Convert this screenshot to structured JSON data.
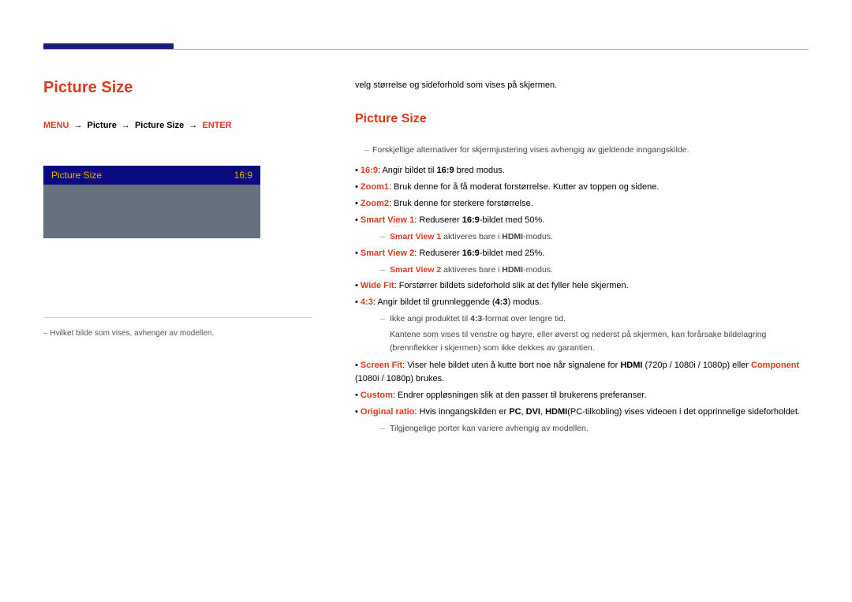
{
  "left": {
    "title_hdr": "Picture Size",
    "title_hdr_overlay": "Picture Size",
    "breadcrumb": {
      "a": "MENU",
      "b": "Picture",
      "c": "Picture Size",
      "d": "ENTER"
    },
    "menu": {
      "label": "Picture Size",
      "value": "16:9"
    },
    "note": "Hvilket bilde som vises, avhenger av modellen."
  },
  "right": {
    "intro": "velg størrelse og sideforhold som vises på skjermen.",
    "h2": "Picture Size",
    "dash1": "Forskjellige alternativer for skjermjustering vises avhengig av gjeldende inngangskilde.",
    "i1_pre": "• ",
    "i1_b": "16:9",
    "i1_txt": ": Angir bildet til ",
    "i1_b2": "16:9",
    "i1_suf": " bred modus.",
    "i2_pre": "• ",
    "i2_b": "Zoom1",
    "i2_txt": ": Bruk denne for å få moderat forstørrelse. Kutter av toppen og sidene.",
    "i3_pre": "• ",
    "i3_b": "Zoom2",
    "i3_txt": ": Bruk denne for sterkere forstørrelse.",
    "i4_pre": "• ",
    "i4_b": "Smart View 1",
    "i4_txt": ": Reduserer ",
    "i4_b2": "16:9",
    "i4_suf": "-bildet med 50%.",
    "i4_note_b": "Smart View 1",
    "i4_note_txt": " aktiveres bare i ",
    "i4_note_b2": "HDMI",
    "i4_note_suf": "-modus.",
    "i5_pre": "• ",
    "i5_b": "Smart View 2",
    "i5_txt": ": Reduserer ",
    "i5_b2": "16:9",
    "i5_suf": "-bildet med 25%.",
    "i5_note_b": "Smart View 2",
    "i5_note_txt": " aktiveres bare i ",
    "i5_note_b2": "HDMI",
    "i5_note_suf": "-modus.",
    "i6_pre": "• ",
    "i6_b": "Wide Fit",
    "i6_txt": ": Forstørrer bildets sideforhold slik at det fyller hele skjermen.",
    "i7_pre": "• ",
    "i7_b": "4:3",
    "i7_txt": ": Angir bildet til grunnleggende (",
    "i7_b2": "4:3",
    "i7_suf": ") modus.",
    "i7_n1": "Ikke angi produktet til ",
    "i7_n1b": "4:3",
    "i7_n1s": "-format over lengre tid.",
    "i7_n2": "Kantene som vises til venstre og høyre, eller øverst og nederst på skjermen, kan forårsake bildelagring (brennflekker i skjermen) som ikke dekkes av garantien.",
    "i8_pre": "• ",
    "i8_b": "Screen Fit",
    "i8_txt": ": Viser hele bildet uten å kutte bort noe når signalene for ",
    "i8_b2": "HDMI",
    "i8_mid": " (720p / 1080i / 1080p) eller ",
    "i8_b3": "Component",
    "i8_suf": " (1080i / 1080p) brukes.",
    "i9_pre": "• ",
    "i9_b": "Custom",
    "i9_txt": ": Endrer oppløsningen slik at den passer til brukerens preferanser.",
    "i10_pre": "• ",
    "i10_b": "Original ratio",
    "i10_txt": ": Hvis inngangskilden er ",
    "i10_b2": "PC",
    "i10_mid": ", ",
    "i10_b3": "DVI",
    "i10_mid2": ", ",
    "i10_b4": "HDMI",
    "i10_suf": "(PC-tilkobling) vises videoen i det opprinnelige sideforholdet.",
    "dash_last": "Tilgjengelige porter kan variere avhengig av modellen."
  }
}
